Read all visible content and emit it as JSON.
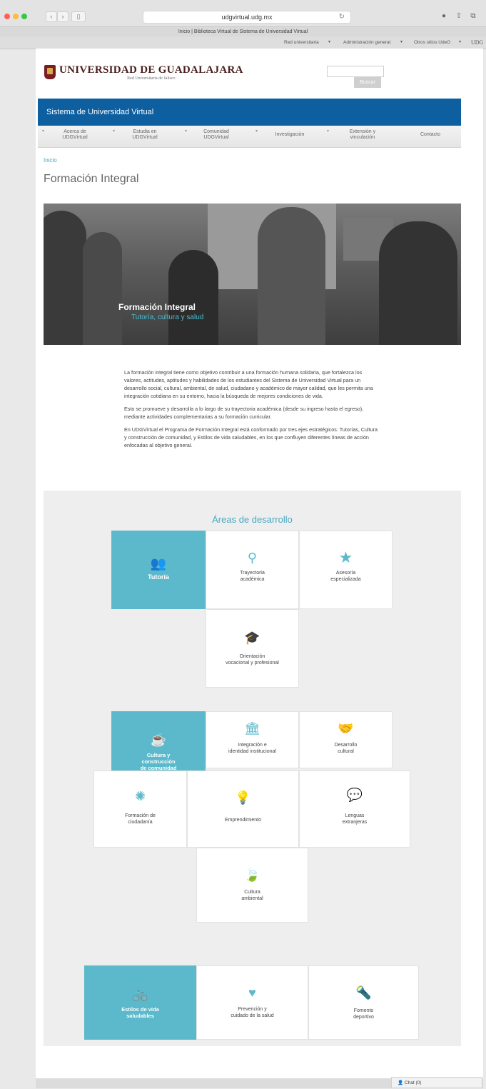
{
  "browser": {
    "url": "udgvirtual.udg.mx",
    "tab_title": "Inicio | Biblioteca Virtual de Sistema de Universidad Virtual",
    "bookmarks": [
      "Red universitaria",
      "Administración general",
      "Otros sitios UdeG",
      "UDG"
    ]
  },
  "header": {
    "logo_title": "UNIVERSIDAD DE GUADALAJARA",
    "logo_subtitle": "Red Universitaria de Jalisco",
    "search_button": "Buscar"
  },
  "banner": {
    "title": "Sistema de Universidad Virtual"
  },
  "nav": {
    "items": [
      {
        "line1": "Acerca de",
        "line2": "UDGVirtual"
      },
      {
        "line1": "Estudia en",
        "line2": "UDGVirtual"
      },
      {
        "line1": "Comunidad",
        "line2": "UDGVirtual"
      },
      {
        "line1": "Investigación",
        "line2": ""
      },
      {
        "line1": "Extensión y",
        "line2": "vinculación"
      },
      {
        "line1": "Contacto",
        "line2": ""
      }
    ]
  },
  "breadcrumb": "Inicio",
  "page_title": "Formación Integral",
  "hero": {
    "title": "Formación Integral",
    "subtitle": "Tutoría, cultura y salud"
  },
  "intro": {
    "p1": "La formación integral tiene como objetivo contribuir a una formación humana solidaria, que fortalezca los valores, actitudes, aptitudes y habilidades de los estudiantes del Sistema de Universidad Virtual para un desarrollo social, cultural, ambiental, de salud, ciudadano y académico de mayor calidad, que les permita una integración cotidiana en su entorno, hacia la búsqueda de mejores condiciones de vida.",
    "p2": "Esto se promueve y desarrolla a lo largo de su trayectoria académica (desde su ingreso hasta el egreso), mediante actividades complementarias a su formación curricular.",
    "p3": "En UDGVirtual el Programa de Formación Integral está conformado por tres ejes estratégicos: Tutorías, Cultura y construcción de comunidad, y Estilos de vida saludables, en los que confluyen diferentes líneas de acción enfocadas al objetivo general."
  },
  "areas": {
    "title": "Áreas de desarrollo",
    "tutoria": {
      "main": {
        "l1": "Tutoría",
        "l2": "",
        "icon": "people-icon"
      },
      "cards": [
        {
          "l1": "Trayectoria",
          "l2": "académica",
          "icon": "pin-icon"
        },
        {
          "l1": "Asesoría",
          "l2": "especializada",
          "icon": "star-icon"
        },
        {
          "l1": "Orientación",
          "l2": "vocacional y profesional",
          "icon": "graduation-cap-icon"
        }
      ]
    },
    "cultura": {
      "main": {
        "l1": "Cultura y",
        "l2": "construcción",
        "l3": "de comunidad",
        "icon": "cup-icon"
      },
      "cards": [
        {
          "l1": "Integración e",
          "l2": "identidad institucional",
          "icon": "institution-icon"
        },
        {
          "l1": "Desarrollo",
          "l2": "cultural",
          "icon": "handshake-icon"
        },
        {
          "l1": "Formación de",
          "l2": "ciudadanía",
          "icon": "seal-icon"
        },
        {
          "l1": "Emprendimiento",
          "l2": "",
          "icon": "lightbulb-icon"
        },
        {
          "l1": "Lenguas",
          "l2": "extranjeras",
          "icon": "chat-icon"
        },
        {
          "l1": "Cultura",
          "l2": "ambiental",
          "icon": "leaf-icon"
        }
      ]
    },
    "salud": {
      "main": {
        "l1": "Estilos de vida",
        "l2": "saludables",
        "icon": "bicycle-icon"
      },
      "cards": [
        {
          "l1": "Prevención y",
          "l2": "cuidado de la salud",
          "icon": "heart-icon"
        },
        {
          "l1": "Fomento",
          "l2": "deportivo",
          "icon": "torch-icon"
        }
      ]
    }
  },
  "chat": {
    "label": "Chat (0)"
  },
  "colors": {
    "accent": "#5bb9cb",
    "banner": "#0e5fa0",
    "logo": "#4a1e1e"
  }
}
